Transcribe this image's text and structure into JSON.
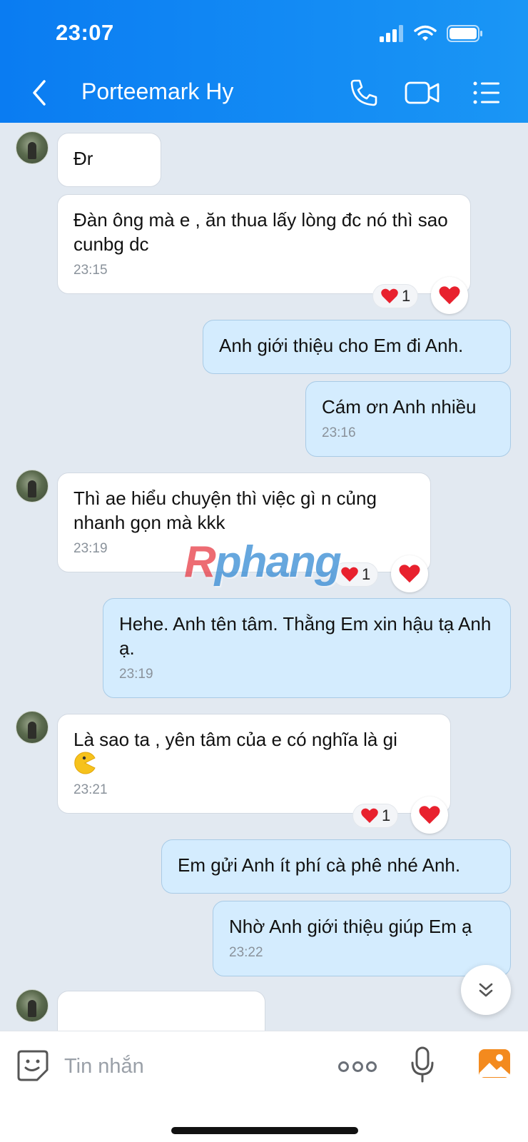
{
  "status_bar": {
    "time": "23:07"
  },
  "header": {
    "title": "Porteemark Hy"
  },
  "messages": [
    {
      "text": "Đr",
      "time": ""
    },
    {
      "text": "Đàn ông mà e , ăn thua lấy lòng đc nó thì sao cunbg dc",
      "time": "23:15",
      "reaction_count": "1"
    },
    {
      "text": "Anh giới thiệu cho Em đi Anh.",
      "time": ""
    },
    {
      "text": "Cám ơn Anh nhiều",
      "time": "23:16"
    },
    {
      "text": "Thì ae hiểu chuyện thì việc gì n củng nhanh gọn mà kkk",
      "time": "23:19",
      "reaction_count": "1"
    },
    {
      "text": "Hehe. Anh tên tâm. Thằng Em xin hậu tạ Anh ạ.",
      "time": "23:19"
    },
    {
      "text": "Là sao ta , yên tâm của e có nghĩa là gi",
      "time": "23:21",
      "reaction_count": "1"
    },
    {
      "text": "Em gửi Anh ít phí cà phê nhé Anh.",
      "time": ""
    },
    {
      "text": "Nhờ Anh giới thiệu giúp Em ạ",
      "time": "23:22"
    }
  ],
  "watermark": {
    "first": "R",
    "rest": "phang"
  },
  "composer": {
    "placeholder": "Tin nhắn"
  },
  "colors": {
    "header": "#0a7cf2",
    "incoming_bubble": "#ffffff",
    "outgoing_bubble": "#d4ecfe",
    "heart": "#e8212e"
  }
}
